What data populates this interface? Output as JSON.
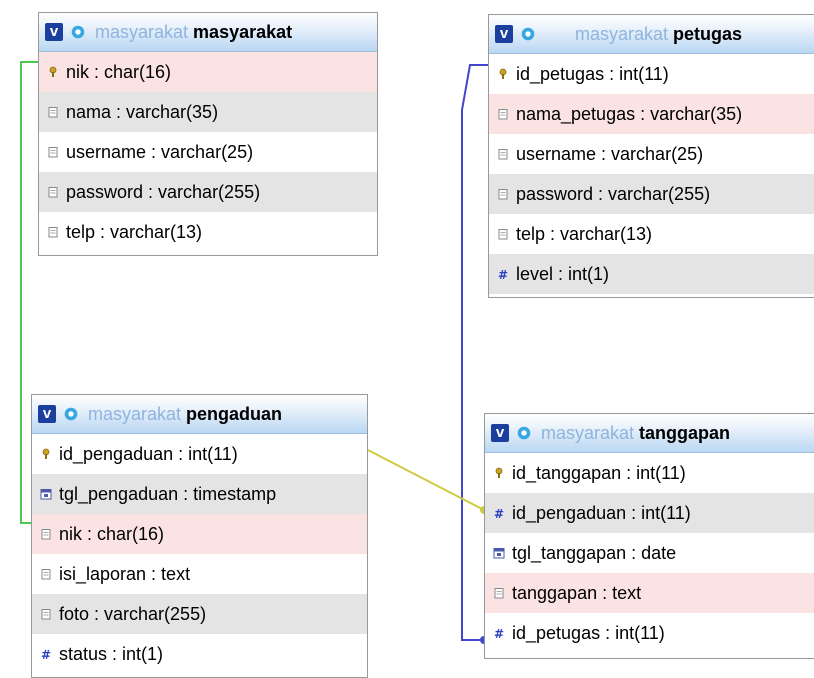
{
  "tables": [
    {
      "id": "masyarakat",
      "db": "masyarakat",
      "name": "masyarakat",
      "columns": [
        {
          "text": "nik : char(16)",
          "icon": "key-icon",
          "bg": "fk"
        },
        {
          "text": "nama : varchar(35)",
          "icon": "column-icon",
          "bg": "alt"
        },
        {
          "text": "username : varchar(25)",
          "icon": "column-icon",
          "bg": "plain"
        },
        {
          "text": "password : varchar(255)",
          "icon": "column-icon",
          "bg": "alt"
        },
        {
          "text": "telp : varchar(13)",
          "icon": "column-icon",
          "bg": "plain"
        }
      ]
    },
    {
      "id": "petugas",
      "db": "masyarakat",
      "name": "petugas",
      "columns": [
        {
          "text": "id_petugas : int(11)",
          "icon": "key-icon",
          "bg": "plain"
        },
        {
          "text": "nama_petugas : varchar(35)",
          "icon": "column-icon",
          "bg": "fk"
        },
        {
          "text": "username : varchar(25)",
          "icon": "column-icon",
          "bg": "plain"
        },
        {
          "text": "password : varchar(255)",
          "icon": "column-icon",
          "bg": "alt"
        },
        {
          "text": "telp : varchar(13)",
          "icon": "column-icon",
          "bg": "plain"
        },
        {
          "text": "level : int(1)",
          "icon": "numeric-icon",
          "bg": "alt"
        }
      ]
    },
    {
      "id": "pengaduan",
      "db": "masyarakat",
      "name": "pengaduan",
      "columns": [
        {
          "text": "id_pengaduan : int(11)",
          "icon": "key-icon",
          "bg": "plain"
        },
        {
          "text": "tgl_pengaduan : timestamp",
          "icon": "date-icon",
          "bg": "alt"
        },
        {
          "text": "nik : char(16)",
          "icon": "column-icon",
          "bg": "fk"
        },
        {
          "text": "isi_laporan : text",
          "icon": "column-icon",
          "bg": "plain"
        },
        {
          "text": "foto : varchar(255)",
          "icon": "column-icon",
          "bg": "alt"
        },
        {
          "text": "status : int(1)",
          "icon": "numeric-icon",
          "bg": "plain"
        }
      ]
    },
    {
      "id": "tanggapan",
      "db": "masyarakat",
      "name": "tanggapan",
      "columns": [
        {
          "text": "id_tanggapan : int(11)",
          "icon": "key-icon",
          "bg": "plain"
        },
        {
          "text": "id_pengaduan : int(11)",
          "icon": "numeric-icon",
          "bg": "alt"
        },
        {
          "text": "tgl_tanggapan : date",
          "icon": "date-icon",
          "bg": "plain"
        },
        {
          "text": "tanggapan : text",
          "icon": "column-icon",
          "bg": "fk"
        },
        {
          "text": "id_petugas : int(11)",
          "icon": "numeric-icon",
          "bg": "plain"
        }
      ]
    }
  ],
  "relations": [
    {
      "from": "masyarakat.nik",
      "to": "pengaduan.nik",
      "color": "#4cc94c"
    },
    {
      "from": "petugas.id_petugas",
      "to": "tanggapan.id_petugas",
      "color": "#4444cc"
    },
    {
      "from": "pengaduan.id_pengaduan",
      "to": "tanggapan.id_pengaduan",
      "color": "#cccc44"
    }
  ]
}
